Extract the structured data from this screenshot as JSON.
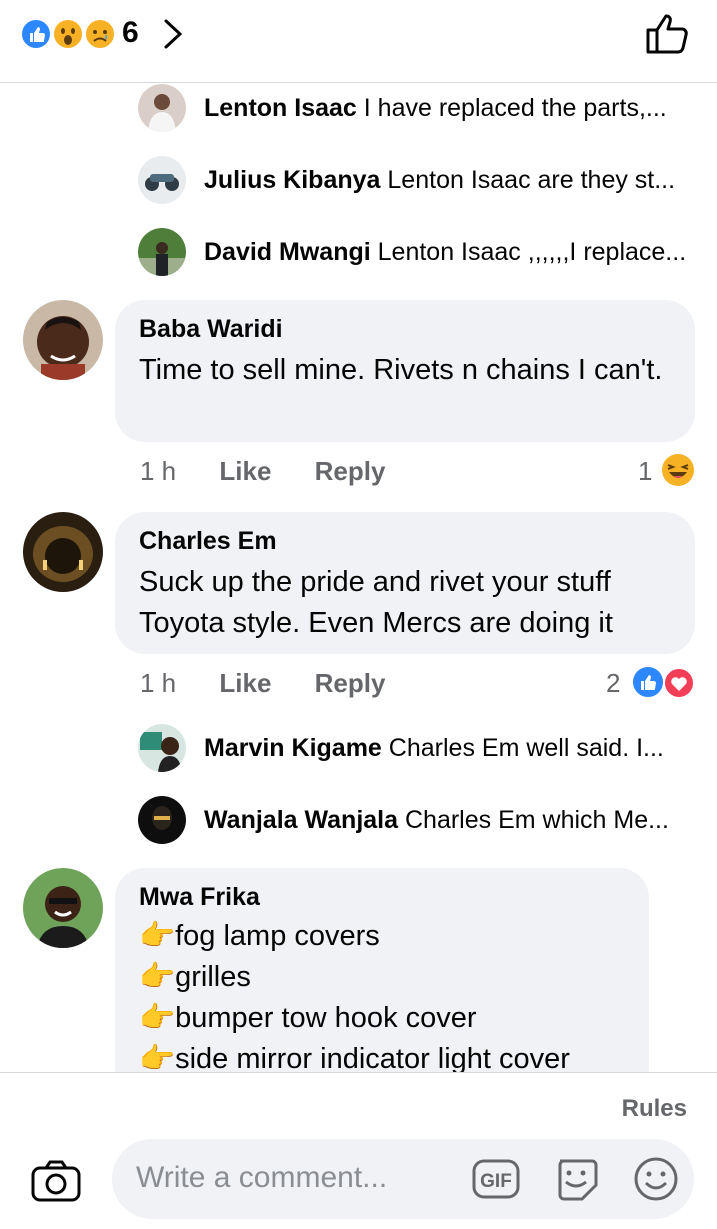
{
  "header": {
    "reaction_count": "6",
    "reactions": [
      "like-reaction",
      "wow-reaction",
      "sad-reaction"
    ]
  },
  "replies_top": [
    {
      "name": "Lenton Isaac",
      "text": "I have replaced the parts,..."
    },
    {
      "name": "Julius Kibanya",
      "text": "Lenton Isaac are they st..."
    },
    {
      "name": "David Mwangi",
      "text": "Lenton Isaac ,,,,,,I replace..."
    }
  ],
  "comments": [
    {
      "name": "Baba Waridi",
      "text": "Time to sell mine. Rivets n chains I can't.",
      "time": "1 h",
      "like_label": "Like",
      "reply_label": "Reply",
      "reaction_count": "1"
    },
    {
      "name": "Charles Em",
      "text": "Suck up the pride and rivet your stuff Toyota style. Even Mercs are doing it",
      "time": "1 h",
      "like_label": "Like",
      "reply_label": "Reply",
      "reaction_count": "2"
    },
    {
      "name": "Mwa Frika",
      "lines": [
        "fog lamp covers",
        "grilles",
        "bumper tow hook cover",
        "side mirror indicator light cover"
      ]
    }
  ],
  "replies_mid": [
    {
      "name": "Marvin Kigame",
      "text": "Charles Em well said. I..."
    },
    {
      "name": "Wanjala Wanjala",
      "text": "Charles Em which Me..."
    }
  ],
  "footer": {
    "rules_label": "Rules",
    "comment_placeholder": "Write a comment...",
    "gif_label": "GIF"
  },
  "colors": {
    "accent_blue": "#2d88ff",
    "bubble_bg": "#f0f2f5",
    "meta_gray": "#65676b"
  }
}
